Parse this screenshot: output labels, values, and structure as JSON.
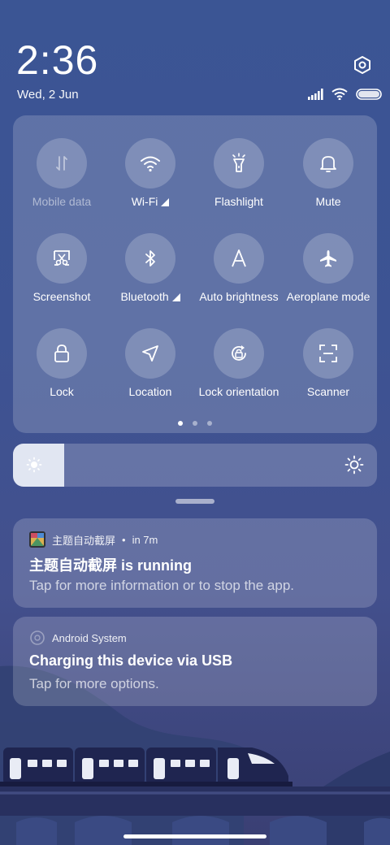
{
  "status": {
    "time": "2:36",
    "date": "Wed, 2 Jun",
    "icons": [
      "signal-icon",
      "wifi-icon",
      "battery-icon"
    ]
  },
  "quick_settings": {
    "tiles": [
      {
        "label": "Mobile data",
        "icon": "mobile-data-icon",
        "enabled": false
      },
      {
        "label": "Wi-Fi",
        "icon": "wifi-icon",
        "enabled": true,
        "expand": true
      },
      {
        "label": "Flashlight",
        "icon": "flashlight-icon",
        "enabled": true
      },
      {
        "label": "Mute",
        "icon": "bell-icon",
        "enabled": true
      },
      {
        "label": "Screenshot",
        "icon": "screenshot-icon",
        "enabled": true
      },
      {
        "label": "Bluetooth",
        "icon": "bluetooth-icon",
        "enabled": true,
        "expand": true
      },
      {
        "label": "Auto brightness",
        "icon": "auto-brightness-icon",
        "enabled": true
      },
      {
        "label": "Aeroplane mode",
        "icon": "airplane-icon",
        "enabled": true
      },
      {
        "label": "Lock",
        "icon": "lock-icon",
        "enabled": true
      },
      {
        "label": "Location",
        "icon": "location-icon",
        "enabled": true
      },
      {
        "label": "Lock orientation",
        "icon": "lock-orientation-icon",
        "enabled": true
      },
      {
        "label": "Scanner",
        "icon": "scanner-icon",
        "enabled": true
      }
    ],
    "page_count": 3,
    "current_page": 1
  },
  "brightness": {
    "level_percent": 14
  },
  "notifications": [
    {
      "app": "主题自动截屏",
      "time": "in 7m",
      "title": "主题自动截屏 is running",
      "text": "Tap for more information or to stop the app."
    },
    {
      "app": "Android System",
      "title": "Charging this device via USB",
      "text": "Tap for more options."
    }
  ],
  "colors": {
    "background_top": "#3b5594",
    "background_bottom": "#3a3f73",
    "train_body": "#1f2550",
    "train_windows": "#e9ecf5"
  }
}
